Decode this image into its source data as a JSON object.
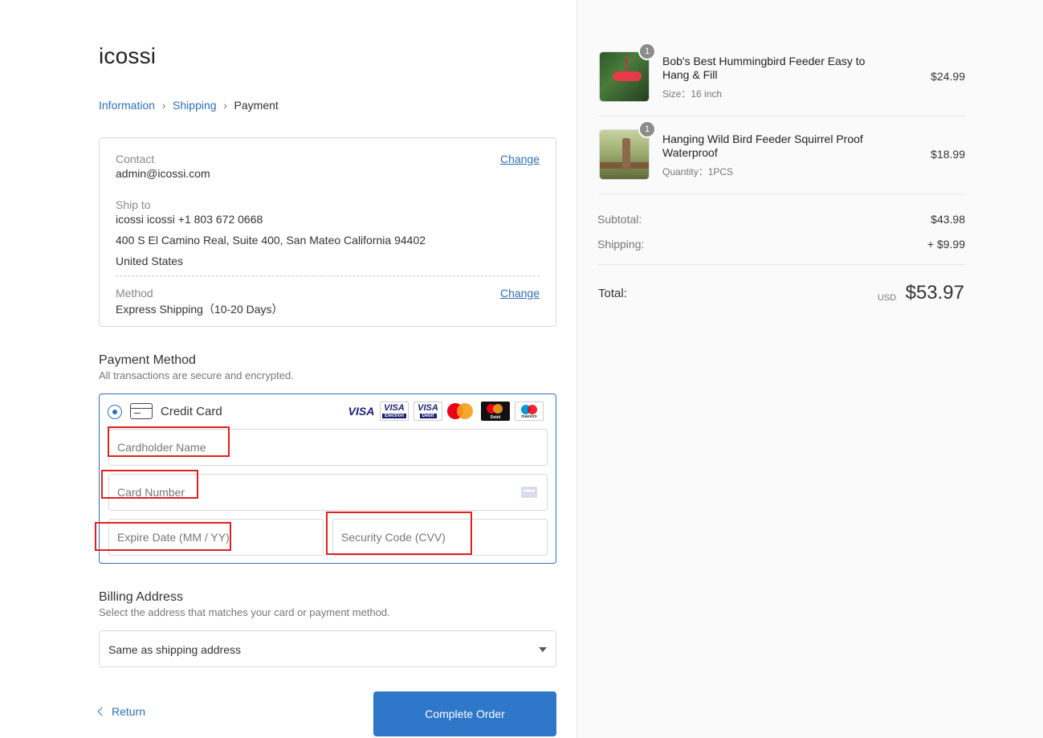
{
  "brand": "icossi",
  "breadcrumb": {
    "information": "Information",
    "shipping": "Shipping",
    "payment": "Payment"
  },
  "summary": {
    "contact_label": "Contact",
    "contact_value": "admin@icossi.com",
    "change_label": "Change",
    "ship_to_label": "Ship to",
    "ship_line1": "icossi  icossi  +1 803 672 0668",
    "ship_line2": "400 S El Camino Real, Suite 400, San Mateo   California   94402",
    "ship_line3": "United States",
    "method_label": "Method",
    "method_value": "Express Shipping（10-20 Days）"
  },
  "payment": {
    "title": "Payment Method",
    "subtitle": "All transactions are secure and encrypted.",
    "option_label": "Credit Card",
    "logos": {
      "visa": "VISA",
      "visa_electron_small": "Electron",
      "visa_debit_small": "Debit",
      "mc_debit_small": "Debit",
      "maestro_small": "maestro"
    },
    "cardholder_placeholder": "Cardholder Name",
    "card_number_placeholder": "Card Number",
    "expire_placeholder": "Expire Date (MM / YY)",
    "cvv_placeholder": "Security Code (CVV)"
  },
  "billing": {
    "title": "Billing Address",
    "subtitle": "Select the address that matches your card or payment method.",
    "selected": "Same as shipping address"
  },
  "actions": {
    "return_label": "Return",
    "complete_label": "Complete Order"
  },
  "cart": {
    "items": [
      {
        "qty": "1",
        "name": "Bob's Best Hummingbird Feeder Easy to Hang & Fill",
        "variant": "Size：16 inch",
        "price": "$24.99"
      },
      {
        "qty": "1",
        "name": "Hanging Wild Bird Feeder Squirrel Proof Waterproof",
        "variant": "Quantity：1PCS",
        "price": "$18.99"
      }
    ],
    "subtotal_label": "Subtotal:",
    "subtotal": "$43.98",
    "shipping_label": "Shipping:",
    "shipping": "+ $9.99",
    "total_label": "Total:",
    "currency": "USD",
    "total": "$53.97"
  },
  "colors": {
    "accent": "#2f77c9",
    "link": "#2f6fb5",
    "highlight": "#e02020"
  }
}
